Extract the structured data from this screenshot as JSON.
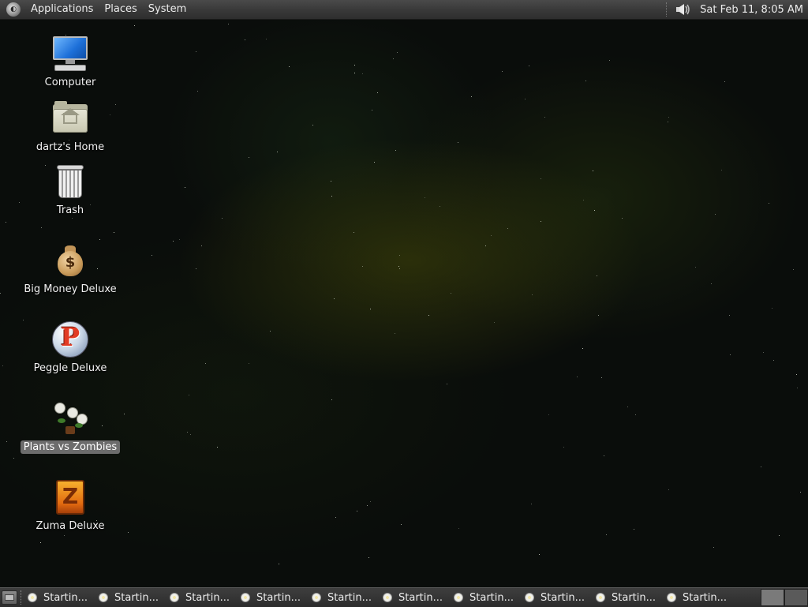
{
  "top_panel": {
    "menus": [
      "Applications",
      "Places",
      "System"
    ],
    "clock": "Sat Feb 11,  8:05 AM",
    "volume_icon": "speaker-icon"
  },
  "desktop_icons": [
    {
      "label": "Computer",
      "icon": "computer-icon"
    },
    {
      "label": "dartz's Home",
      "icon": "home-folder-icon"
    },
    {
      "label": "Trash",
      "icon": "trash-icon"
    },
    {
      "label": "Big Money Deluxe",
      "icon": "money-bag-icon"
    },
    {
      "label": "Peggle Deluxe",
      "icon": "peggle-icon"
    },
    {
      "label": "Plants vs Zombies",
      "icon": "plants-vs-zombies-icon",
      "selected": true
    },
    {
      "label": "Zuma Deluxe",
      "icon": "zuma-icon"
    }
  ],
  "taskbar": {
    "tasks": [
      "Startin...",
      "Startin...",
      "Startin...",
      "Startin...",
      "Startin...",
      "Startin...",
      "Startin...",
      "Startin...",
      "Startin...",
      "Startin..."
    ]
  }
}
